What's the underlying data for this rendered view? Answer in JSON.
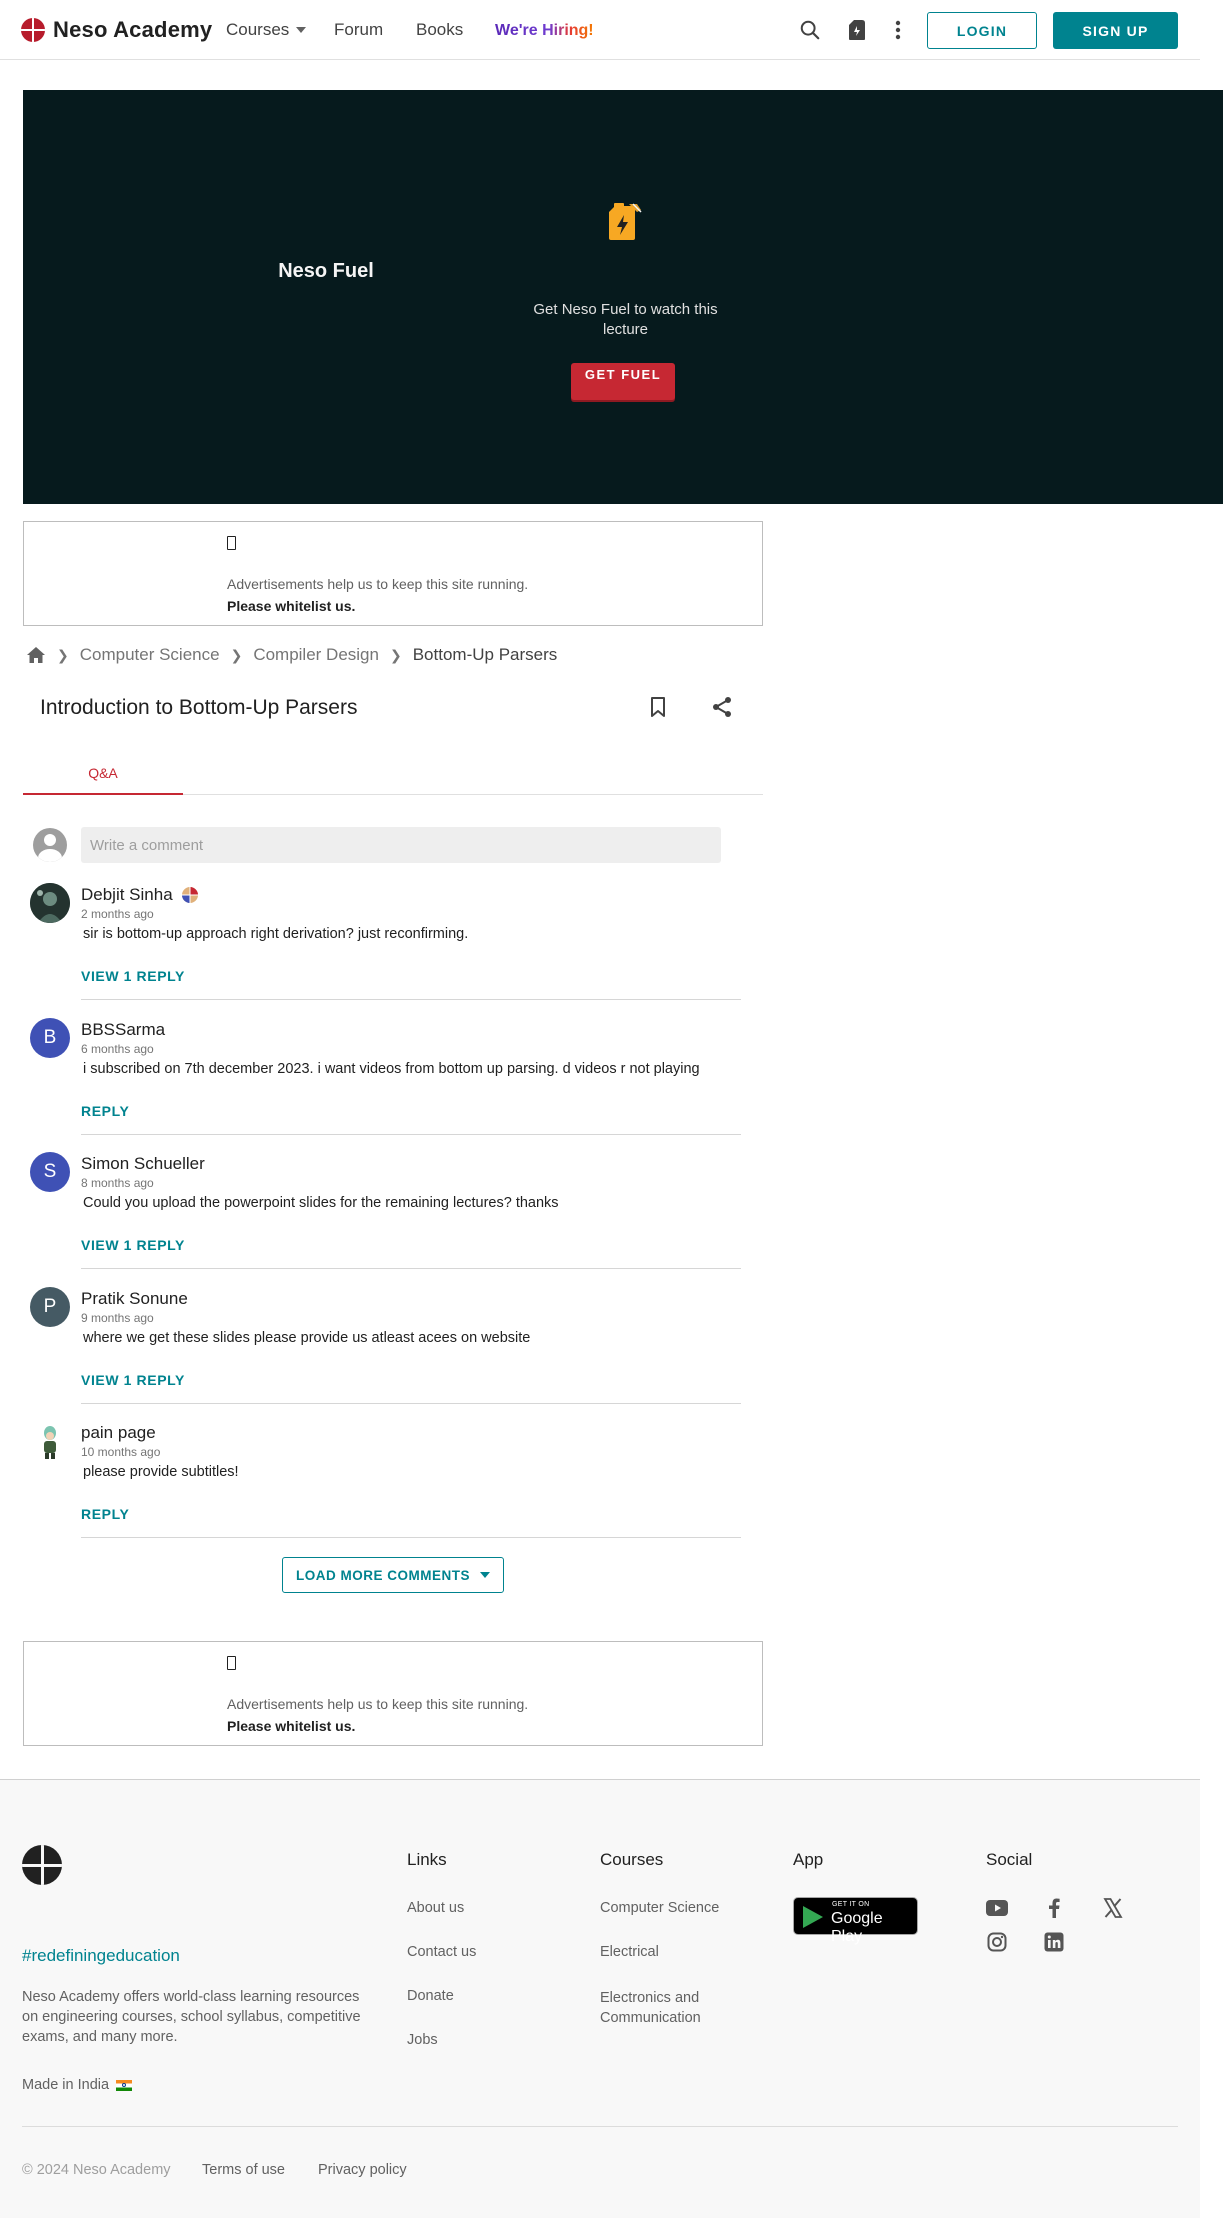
{
  "header": {
    "logo_text": "Neso Academy",
    "nav": {
      "courses": "Courses",
      "forum": "Forum",
      "books": "Books",
      "hiring": "We're Hiring!"
    },
    "login": "LOGIN",
    "signup": "SIGN UP"
  },
  "player": {
    "fuel_title": "Neso Fuel",
    "fuel_desc": "Get Neso Fuel to watch this lecture",
    "fuel_button": "GET FUEL"
  },
  "ads": {
    "line1": "Advertisements help us to keep this site running.",
    "line2": "Please whitelist us."
  },
  "breadcrumb": {
    "items": [
      "Computer Science",
      "Compiler Design",
      "Bottom-Up Parsers"
    ]
  },
  "lecture": {
    "title": "Introduction to Bottom-Up Parsers"
  },
  "tabs": {
    "qa": "Q&A"
  },
  "comment_box": {
    "placeholder": "Write a comment"
  },
  "comments": [
    {
      "name": "Debjit Sinha",
      "time": "2 months ago",
      "text": "sir is bottom-up approach right derivation? just reconfirming.",
      "action": "VIEW 1 REPLY",
      "avatar_letter": ""
    },
    {
      "name": "BBSSarma",
      "time": "6 months ago",
      "text": "i subscribed on 7th december 2023. i want videos from bottom up parsing. d videos r not playing",
      "action": "REPLY",
      "avatar_letter": "B"
    },
    {
      "name": "Simon Schueller",
      "time": "8 months ago",
      "text": "Could you upload the powerpoint slides for the remaining lectures? thanks",
      "action": "VIEW 1 REPLY",
      "avatar_letter": "S"
    },
    {
      "name": "Pratik Sonune",
      "time": "9 months ago",
      "text": "where we get these slides please provide us atleast acees on website",
      "action": "VIEW 1 REPLY",
      "avatar_letter": "P"
    },
    {
      "name": "pain page",
      "time": "10 months ago",
      "text": "please provide subtitles!",
      "action": "REPLY",
      "avatar_letter": ""
    }
  ],
  "load_more": "LOAD MORE COMMENTS",
  "footer": {
    "tagline": "#redefiningeducation",
    "description": "Neso Academy offers world-class learning resources on engineering courses, school syllabus, competitive exams, and many more.",
    "made_in": "Made in India",
    "links_title": "Links",
    "links": [
      "About us",
      "Contact us",
      "Donate",
      "Jobs"
    ],
    "courses_title": "Courses",
    "courses": [
      "Computer Science",
      "Electrical",
      "Electronics and Communication"
    ],
    "app_title": "App",
    "gplay_small": "GET IT ON",
    "gplay_big": "Google Play",
    "social_title": "Social",
    "copyright": "© 2024 Neso Academy",
    "terms": "Terms of use",
    "privacy": "Privacy policy"
  },
  "colors": {
    "brand_teal": "#00838f",
    "brand_red": "#c62833",
    "player_bg": "#061a1d"
  }
}
